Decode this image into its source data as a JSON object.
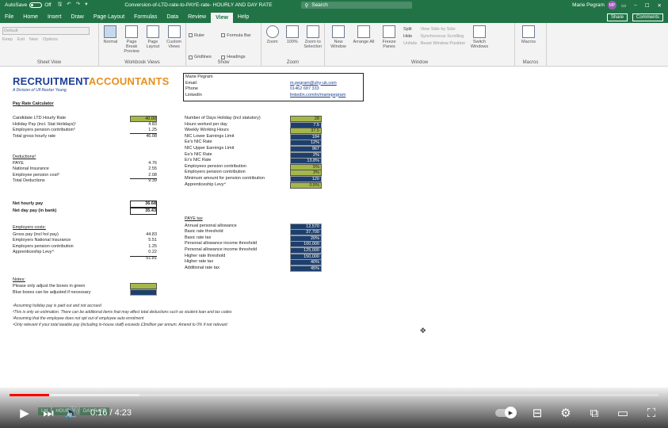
{
  "window": {
    "autosave_label": "AutoSave",
    "autosave_state": "Off",
    "title": "Conversion-of-LTD-rate-to-PAYE-rate- HOURLY AND DAY RATE",
    "search_placeholder": "Search",
    "user_name": "Marie Pegram",
    "user_initials": "MP"
  },
  "menu": {
    "tabs": [
      "File",
      "Home",
      "Insert",
      "Draw",
      "Page Layout",
      "Formulas",
      "Data",
      "Review",
      "View",
      "Help"
    ],
    "active_tab": "View",
    "share_label": "Share",
    "comments_label": "Comments"
  },
  "ribbon": {
    "sheet_view": {
      "name": "Sheet View",
      "dropdown": "Default",
      "keep": "Keep",
      "exit": "Exit",
      "new": "New",
      "options": "Options"
    },
    "workbook_views": {
      "name": "Workbook Views",
      "normal": "Normal",
      "page_break": "Page Break Preview",
      "page_layout": "Page Layout",
      "custom": "Custom Views"
    },
    "show": {
      "name": "Show",
      "ruler": "Ruler",
      "formula_bar": "Formula Bar",
      "gridlines": "Gridlines",
      "headings": "Headings"
    },
    "zoom": {
      "name": "Zoom",
      "zoom": "Zoom",
      "hundred": "100%",
      "to_selection": "Zoom to Selection"
    },
    "window": {
      "name": "Window",
      "new_window": "New Window",
      "arrange_all": "Arrange All",
      "freeze": "Freeze Panes",
      "split": "Split",
      "hide": "Hide",
      "unhide": "Unhide",
      "side_by_side": "View Side by Side",
      "sync_scroll": "Synchronous Scrolling",
      "reset_pos": "Reset Window Position",
      "switch": "Switch Windows"
    },
    "macros": {
      "name": "Macros",
      "macros": "Macros"
    }
  },
  "sheet": {
    "logo_part1": "RECRUITMENT",
    "logo_part2": "ACCOUNTANTS",
    "tagline": "A Division of Ulf Recker Young",
    "contact": [
      {
        "k": "Marie Pegram",
        "v": ""
      },
      {
        "k": "Email:",
        "v": "m.pegram@uhy-uk.com"
      },
      {
        "k": "Phone",
        "v": "01462 687 333"
      },
      {
        "k": "LinkedIn",
        "v": "linkedin.com/in/mariepegram"
      }
    ],
    "left": {
      "heading": "Pay Rate Calculator",
      "rows1": [
        {
          "label": "Candidate LTD Hourly Rate",
          "value": "40.00",
          "style": "green"
        },
        {
          "label": "Holiday Pay (incl. Stat Holidays)¹",
          "value": "4.83"
        },
        {
          "label": "Employers pension contribution³",
          "value": "1.25"
        },
        {
          "label": "Total gross hourly rate",
          "value": "46.08"
        }
      ],
      "deductions_heading": "Deductions²",
      "rows2": [
        {
          "label": "PAYE",
          "value": "4.76"
        },
        {
          "label": "National Insurance",
          "value": "2.55"
        },
        {
          "label": "Employee pension cost³",
          "value": "2.08"
        },
        {
          "label": "Total Deductions",
          "value": "9.39"
        }
      ],
      "net_hourly_label": "Net hourly pay",
      "net_hourly": "36.68",
      "net_day_label": "Net day pay (in bank)",
      "net_day": "35.43",
      "employers_heading": "Employers costs:",
      "rows3": [
        {
          "label": "Gross pay (incl hol pay)",
          "value": "44.83"
        },
        {
          "label": "Employers National Insurance",
          "value": "5.51"
        },
        {
          "label": "Employers pension contribution",
          "value": "1.25"
        },
        {
          "label": "Apprenticeship Levy⁴",
          "value": "0.22"
        },
        {
          "label": "",
          "value": "51.81"
        }
      ],
      "notes_heading": "Notes:",
      "notes": [
        "Please only adjust the boxes in green",
        "Blue boxes can be adjusted if necessary"
      ]
    },
    "right": {
      "rows1": [
        {
          "label": "Number of Days Holiday (incl statutory)",
          "value": "28",
          "style": "green"
        },
        {
          "label": "Hours worked per day",
          "value": "7.5",
          "style": "blue"
        },
        {
          "label": "Weekly Working Hours",
          "value": "37.5",
          "style": "green"
        },
        {
          "label": "NIC Lower Earnings Limit",
          "value": "184",
          "style": "blue"
        },
        {
          "label": "Ee's NIC Rate",
          "value": "12%",
          "style": "blue"
        },
        {
          "label": "NIC Upper Earnings Limit",
          "value": "967",
          "style": "blue"
        },
        {
          "label": "Ee's NIC Rate",
          "value": "2%",
          "style": "blue"
        },
        {
          "label": "Er's NIC Rate",
          "value": "13.8%",
          "style": "blue"
        },
        {
          "label": "Employees pension contribution",
          "value": "5%",
          "style": "green"
        },
        {
          "label": "Employers pension contribution",
          "value": "3%",
          "style": "green"
        },
        {
          "label": "Minimum amount for pension contribution",
          "value": "120",
          "style": "blue"
        },
        {
          "label": "Apprenticeship Levy⁴",
          "value": "0.5%",
          "style": "green"
        }
      ],
      "paye_heading": "PAYE tax",
      "rows2": [
        {
          "label": "Annual personal allowance",
          "value": "12,570"
        },
        {
          "label": "Basic rate threshold",
          "value": "37,700"
        },
        {
          "label": "Basic rate tax",
          "value": "20%"
        },
        {
          "label": "Personal allowance income threshold",
          "value": "100,000"
        },
        {
          "label": "Personal allowance income threshold",
          "value": "125,000"
        },
        {
          "label": "Higher rate threshold",
          "value": "150,000"
        },
        {
          "label": "Higher rate tax",
          "value": "40%"
        },
        {
          "label": "Additional rate tax",
          "value": "45%"
        }
      ]
    },
    "footnotes": [
      "¹Assuming holiday pay is paid out and not accrued",
      "²This is only an estimation. There can be additional items that may affect total deductions such as student loan and tax codes",
      "³Assuming that the employee does not opt out of employee auto enrolment",
      "⁴Only relevant if your total taxable pay (including in-house staff) exceeds £3million per annum. Amend to 0% if not relevant"
    ],
    "sheet_tabs": [
      "Ltd",
      "HOURLY",
      "DAY RATE"
    ]
  },
  "player": {
    "current_time": "0:16",
    "duration": "4:23",
    "time_separator": " / ",
    "progress_fraction": 0.061,
    "buffered_fraction": 0.2
  }
}
